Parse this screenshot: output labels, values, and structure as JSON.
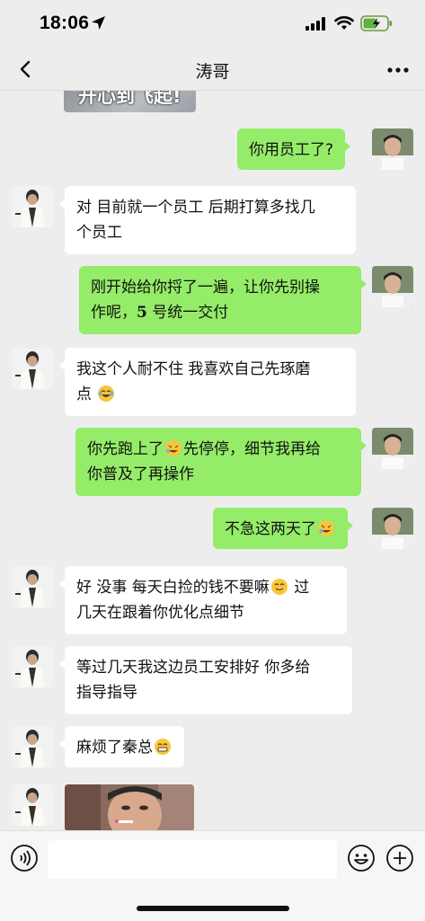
{
  "status": {
    "time": "18:06"
  },
  "nav": {
    "title": "涛哥"
  },
  "top_image_caption": "开心到飞起!",
  "messages": [
    {
      "side": "out",
      "text": "你用员工了?"
    },
    {
      "side": "in",
      "line1": "对 目前就一个员工 后期打算多找几",
      "line2": "个员工"
    },
    {
      "side": "out",
      "line1": "刚开始给你捋了一遍，让你先别操",
      "line2a": "作呢，",
      "line2num": "5",
      "line2b": "号统一交付"
    },
    {
      "side": "in",
      "line1": "我这个人耐不住 我喜欢自己先琢磨",
      "line2": "点"
    },
    {
      "side": "out",
      "line1a": "你先跑上了",
      "line1b": "先停停，细节我再给",
      "line2": "你普及了再操作"
    },
    {
      "side": "out",
      "text": "不急这两天了"
    },
    {
      "side": "in",
      "line1a": "好 没事 每天白捡的钱不要嘛",
      "line1b": " 过",
      "line2": "几天在跟着你优化点细节"
    },
    {
      "side": "in",
      "line1": "等过几天我这边员工安排好 你多给",
      "line2": "指导指导"
    },
    {
      "side": "in",
      "text": "麻烦了秦总"
    }
  ],
  "colors": {
    "out_bubble": "#95ec69",
    "in_bubble": "#ffffff",
    "background": "#ededed"
  },
  "icons": {
    "back": "chevron-left-icon",
    "more": "more-dots-icon",
    "voice": "voice-icon",
    "emoji": "emoji-icon",
    "add": "plus-icon"
  }
}
